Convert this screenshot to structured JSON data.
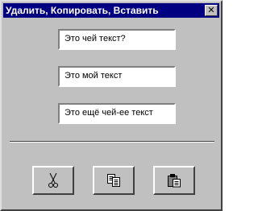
{
  "window": {
    "title": "Удалить, Копировать, Вставить",
    "close_glyph": "✕"
  },
  "fields": [
    {
      "value": "Это чей текст?"
    },
    {
      "value": "Это мой текст"
    },
    {
      "value": "Это ещё чей-ее текст"
    }
  ],
  "toolbar": {
    "cut_icon": "scissors-icon",
    "copy_icon": "copy-icon",
    "paste_icon": "paste-icon"
  },
  "colors": {
    "titlebar": "#000080",
    "face": "#c0c0c0"
  }
}
